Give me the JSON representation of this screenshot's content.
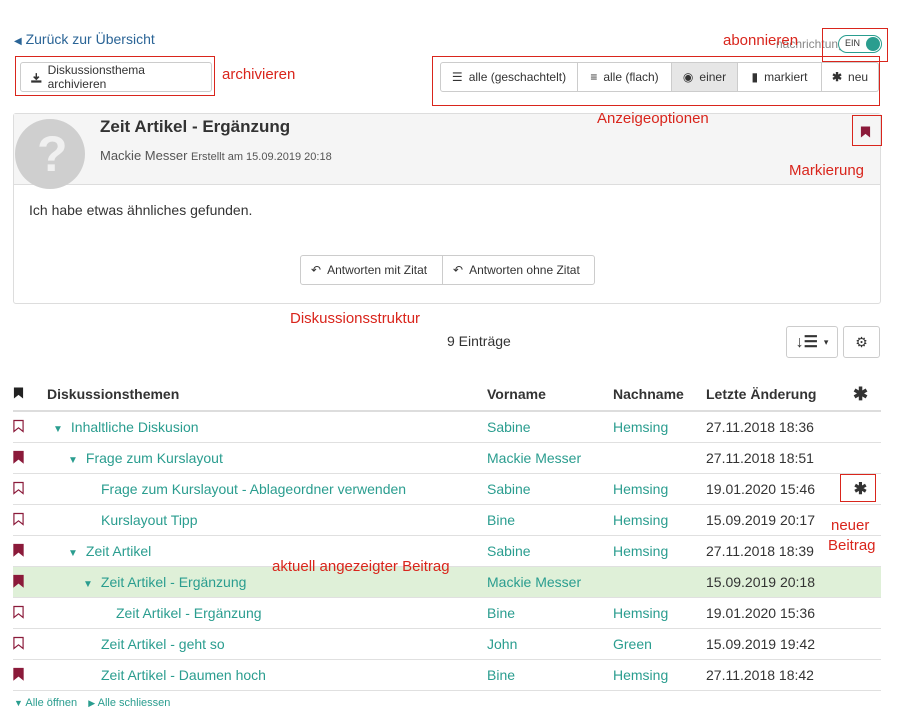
{
  "nav": {
    "back_label": "Zurück zur Übersicht"
  },
  "toolbar": {
    "archive_label": "Diskussionsthema archivieren"
  },
  "subscribe": {
    "partial_label": "nachrichtungen",
    "toggle_label": "EIN"
  },
  "view_options": {
    "nested": "alle (geschachtelt)",
    "flat": "alle (flach)",
    "single": "einer",
    "marked": "markiert",
    "new": "neu"
  },
  "post": {
    "title": "Zeit Artikel - Ergänzung",
    "author": "Mackie Messer",
    "created": "Erstellt am 15.09.2019 20:18",
    "body": "Ich habe etwas ähnliches gefunden.",
    "reply_quote": "Antworten mit Zitat",
    "reply_noquote": "Antworten ohne Zitat"
  },
  "list": {
    "count_label": "9 Einträge"
  },
  "table": {
    "headers": {
      "topic": "Diskussionsthemen",
      "firstname": "Vorname",
      "lastname": "Nachname",
      "changed": "Letzte Änderung"
    },
    "rows": [
      {
        "marked": false,
        "level": 0,
        "expander": true,
        "title": "Inhaltliche Diskusion",
        "firstname": "Sabine",
        "lastname": "Hemsing",
        "changed": "27.11.2018 18:36",
        "new": false,
        "current": false
      },
      {
        "marked": true,
        "level": 1,
        "expander": true,
        "title": "Frage zum Kurslayout",
        "firstname": "Mackie Messer",
        "lastname": "",
        "changed": "27.11.2018 18:51",
        "new": false,
        "current": false
      },
      {
        "marked": false,
        "level": 2,
        "expander": false,
        "title": "Frage zum Kurslayout - Ablageordner verwenden",
        "firstname": "Sabine",
        "lastname": "Hemsing",
        "changed": "19.01.2020 15:46",
        "new": true,
        "current": false
      },
      {
        "marked": false,
        "level": 2,
        "expander": false,
        "title": "Kurslayout Tipp",
        "firstname": "Bine",
        "lastname": "Hemsing",
        "changed": "15.09.2019 20:17",
        "new": false,
        "current": false
      },
      {
        "marked": true,
        "level": 1,
        "expander": true,
        "title": "Zeit Artikel",
        "firstname": "Sabine",
        "lastname": "Hemsing",
        "changed": "27.11.2018 18:39",
        "new": false,
        "current": false
      },
      {
        "marked": true,
        "level": 2,
        "expander": true,
        "title": "Zeit Artikel - Ergänzung",
        "firstname": "Mackie Messer",
        "lastname": "",
        "changed": "15.09.2019 20:18",
        "new": false,
        "current": true
      },
      {
        "marked": false,
        "level": 3,
        "expander": false,
        "title": "Zeit Artikel - Ergänzung",
        "firstname": "Bine",
        "lastname": "Hemsing",
        "changed": "19.01.2020 15:36",
        "new": false,
        "current": false
      },
      {
        "marked": false,
        "level": 2,
        "expander": false,
        "title": "Zeit Artikel - geht so",
        "firstname": "John",
        "lastname": "Green",
        "changed": "15.09.2019 19:42",
        "new": false,
        "current": false
      },
      {
        "marked": true,
        "level": 2,
        "expander": false,
        "title": "Zeit Artikel - Daumen hoch",
        "firstname": "Bine",
        "lastname": "Hemsing",
        "changed": "27.11.2018 18:42",
        "new": false,
        "current": false
      }
    ]
  },
  "footer": {
    "open_all": "Alle öffnen",
    "close_all": "Alle schliessen"
  },
  "annotations": {
    "archive": "archivieren",
    "subscribe": "abonnieren",
    "view_options": "Anzeigeoptionen",
    "marking": "Markierung",
    "structure": "Diskussionsstruktur",
    "current_post": "aktuell angezeigter Beitrag",
    "new_post_1": "neuer",
    "new_post_2": "Beitrag"
  },
  "colors": {
    "annotation": "#d9251c",
    "bookmark": "#8b1a3a",
    "teal": "#2a9d8f",
    "current_row": "#dff0d8"
  }
}
